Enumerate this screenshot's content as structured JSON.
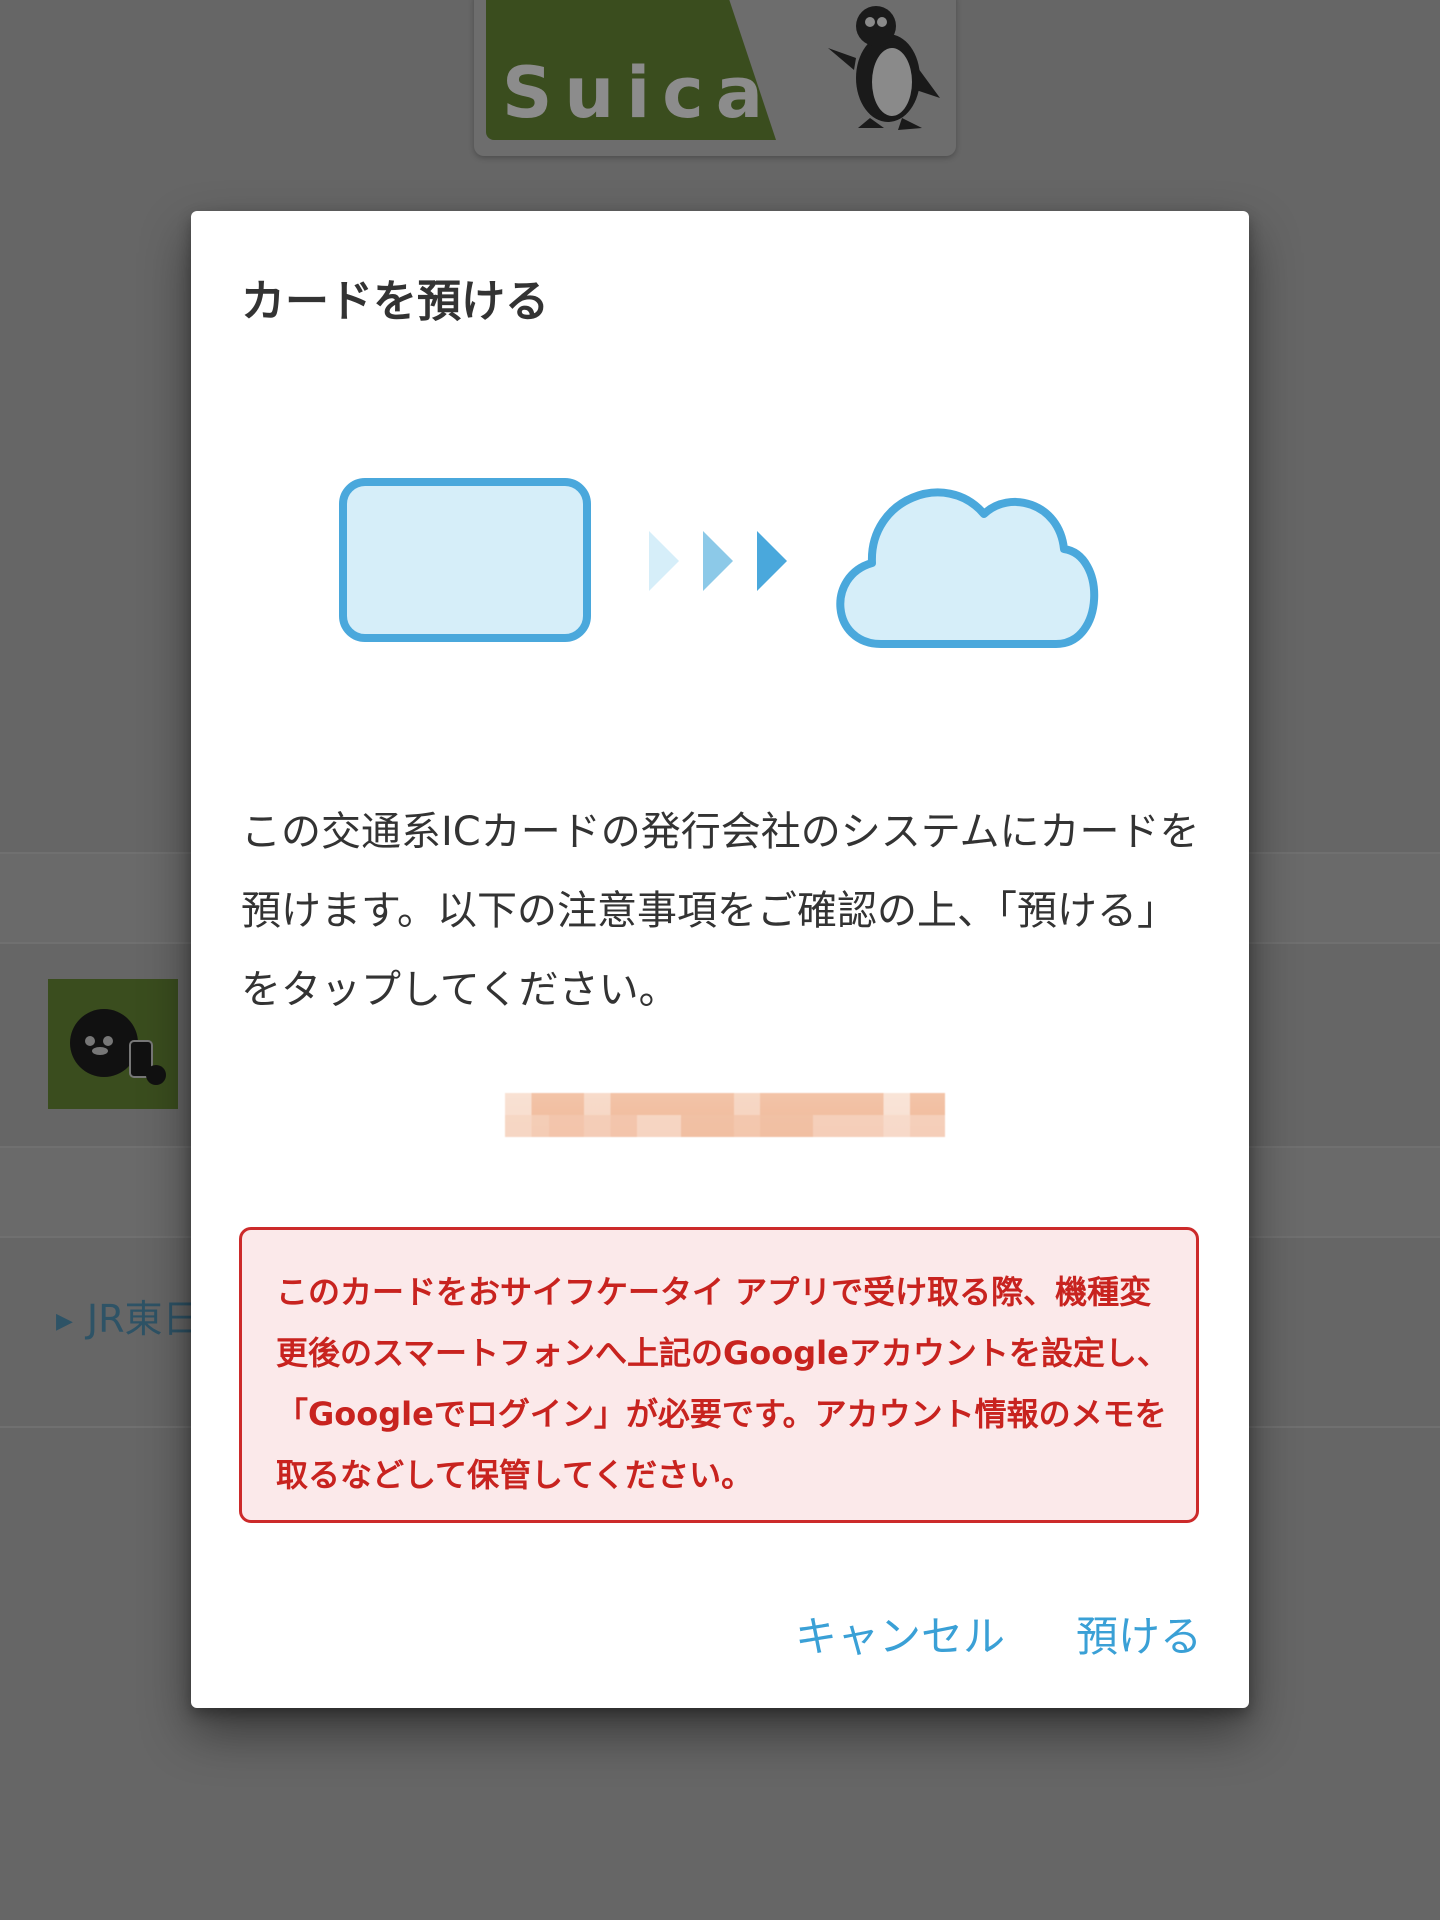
{
  "background": {
    "card_logo_text": "Suica",
    "link_text": "JR東日"
  },
  "dialog": {
    "title": "カードを預ける",
    "illustration_icons": [
      "card-icon",
      "arrows-icon",
      "cloud-icon"
    ],
    "body": "この交通系ICカードの発行会社のシステムにカードを預けます。以下の注意事項をご確認の上、「預ける」をタップしてください。",
    "account_masked": "",
    "warning": "このカードをおサイフケータイ アプリで受け取る際、機種変更後のスマートフォンへ上記のGoogleアカウントを設定し、「Googleでログイン」が必要です。アカウント情報のメモを取るなどして保管してください。",
    "buttons": {
      "cancel": "キャンセル",
      "deposit": "預ける"
    }
  },
  "colors": {
    "accent": "#3aa0d6",
    "warning_text": "#c8231f",
    "warning_border": "#cc2a2a",
    "warning_bg": "#fbe9ea",
    "illustration_stroke": "#4aa8dc",
    "illustration_fill": "#d6eef9"
  }
}
